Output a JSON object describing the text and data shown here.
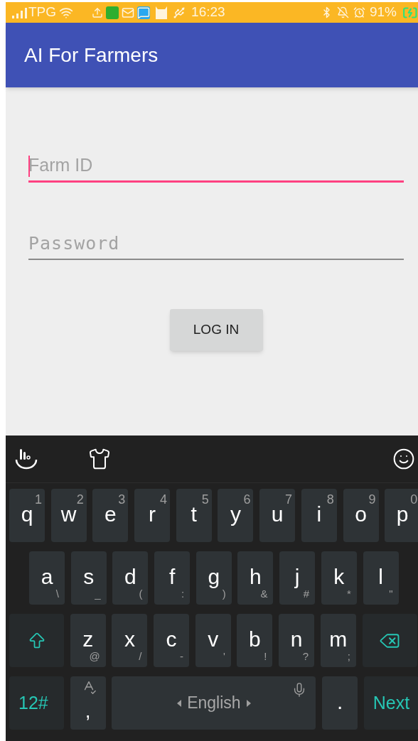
{
  "status_bar": {
    "carrier": "TPG",
    "time": "16:23",
    "battery": "91%"
  },
  "app_bar": {
    "title": "AI For Farmers"
  },
  "fields": [
    {
      "placeholder": "Farm ID",
      "focused": true,
      "kind": "text"
    },
    {
      "placeholder": "Password",
      "focused": false,
      "kind": "password"
    }
  ],
  "login_button": "LOG IN",
  "keyboard": {
    "top_row": [
      {
        "kind": "letter",
        "main": "q",
        "sub": "1"
      },
      {
        "kind": "letter",
        "main": "w",
        "sub": "2"
      },
      {
        "kind": "letter",
        "main": "e",
        "sub": "3"
      },
      {
        "kind": "letter",
        "main": "r",
        "sub": "4"
      },
      {
        "kind": "letter",
        "main": "t",
        "sub": "5"
      },
      {
        "kind": "letter",
        "main": "y",
        "sub": "6"
      },
      {
        "kind": "letter",
        "main": "u",
        "sub": "7"
      },
      {
        "kind": "letter",
        "main": "i",
        "sub": "8"
      },
      {
        "kind": "letter",
        "main": "o",
        "sub": "9"
      },
      {
        "kind": "letter",
        "main": "p",
        "sub": "0"
      }
    ],
    "middle_row": [
      {
        "kind": "letter",
        "main": "a",
        "sub": "\\"
      },
      {
        "kind": "letter",
        "main": "s",
        "sub": "_"
      },
      {
        "kind": "letter",
        "main": "d",
        "sub": "("
      },
      {
        "kind": "letter",
        "main": "f",
        "sub": ":"
      },
      {
        "kind": "letter",
        "main": "g",
        "sub": ")"
      },
      {
        "kind": "letter",
        "main": "h",
        "sub": "&"
      },
      {
        "kind": "letter",
        "main": "j",
        "sub": "#"
      },
      {
        "kind": "letter",
        "main": "k",
        "sub": "*"
      },
      {
        "kind": "letter",
        "main": "l",
        "sub": "\""
      }
    ],
    "bottom_row": [
      {
        "kind": "shift"
      },
      {
        "kind": "letter",
        "main": "z",
        "sub": "@"
      },
      {
        "kind": "letter",
        "main": "x",
        "sub": "/"
      },
      {
        "kind": "letter",
        "main": "c",
        "sub": "-"
      },
      {
        "kind": "letter",
        "main": "v",
        "sub": "'"
      },
      {
        "kind": "letter",
        "main": "b",
        "sub": "!"
      },
      {
        "kind": "letter",
        "main": "n",
        "sub": "?"
      },
      {
        "kind": "letter",
        "main": "m",
        "sub": ";"
      },
      {
        "kind": "backspace"
      }
    ],
    "function_row": [
      {
        "kind": "action",
        "main": "12#"
      },
      {
        "kind": "comma",
        "main": ","
      },
      {
        "kind": "space",
        "main": "English"
      },
      {
        "kind": "letter",
        "main": "."
      },
      {
        "kind": "action",
        "main": "Next"
      }
    ]
  }
}
